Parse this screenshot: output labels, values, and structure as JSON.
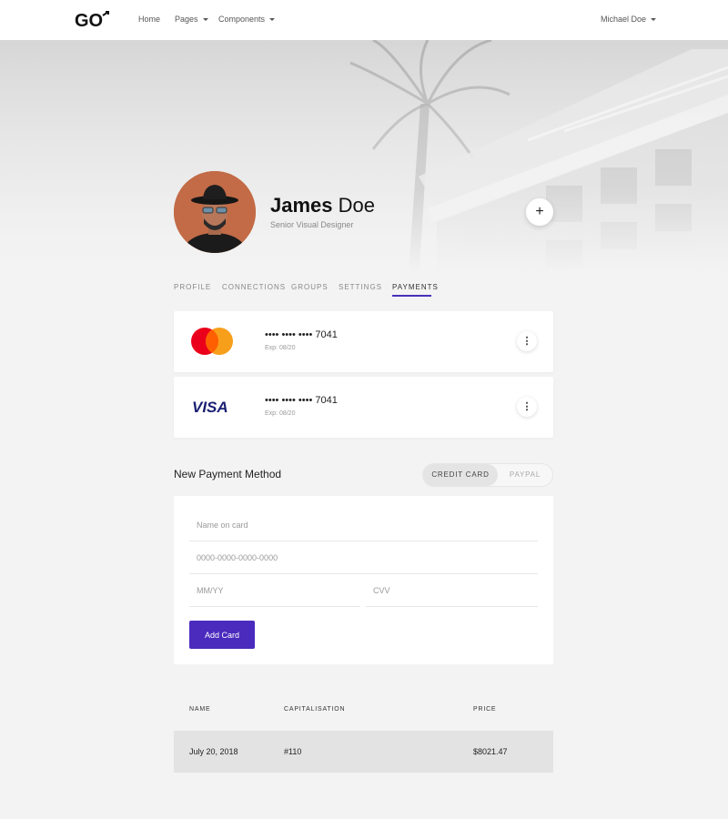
{
  "navbar": {
    "logo_text": "GO",
    "links": [
      {
        "label": "Home",
        "has_caret": false
      },
      {
        "label": "Pages",
        "has_caret": true
      },
      {
        "label": "Components",
        "has_caret": true
      }
    ],
    "user_menu": "Michael Doe"
  },
  "profile": {
    "first_name": "James",
    "last_name": "Doe",
    "role": "Senior Visual Designer",
    "add_icon": "plus-icon"
  },
  "tabs": [
    {
      "label": "PROFILE",
      "active": false
    },
    {
      "label": "CONNECTIONS",
      "active": false
    },
    {
      "label": "GROUPS",
      "active": false
    },
    {
      "label": "SETTINGS",
      "active": false
    },
    {
      "label": "PAYMENTS",
      "active": true
    }
  ],
  "cards": [
    {
      "brand": "mastercard-icon",
      "number": "•••• •••• •••• 7041",
      "exp": "Exp: 08/20"
    },
    {
      "brand": "visa-icon",
      "brand_text": "VISA",
      "number": "•••• •••• •••• 7041",
      "exp": "Exp: 08/20"
    }
  ],
  "new_payment": {
    "title": "New Payment Method",
    "toggle": {
      "credit": "CREDIT CARD",
      "paypal": "PAYPAL",
      "selected": "CREDIT CARD"
    },
    "name_placeholder": "Name on card",
    "number_placeholder": "0000-0000-0000-0000",
    "expiry_placeholder": "MM/YY",
    "cvv_placeholder": "CVV",
    "submit_label": "Add Card"
  },
  "table": {
    "headers": [
      "NAME",
      "CAPITALISATION",
      "PRICE"
    ],
    "rows": [
      [
        "July 20, 2018",
        "#110",
        "$8021.47"
      ]
    ]
  },
  "colors": {
    "accent": "#4a2bbd",
    "mastercard_red": "#eb001b",
    "mastercard_orange": "#f79e1b",
    "visa_blue": "#1a1f71"
  }
}
